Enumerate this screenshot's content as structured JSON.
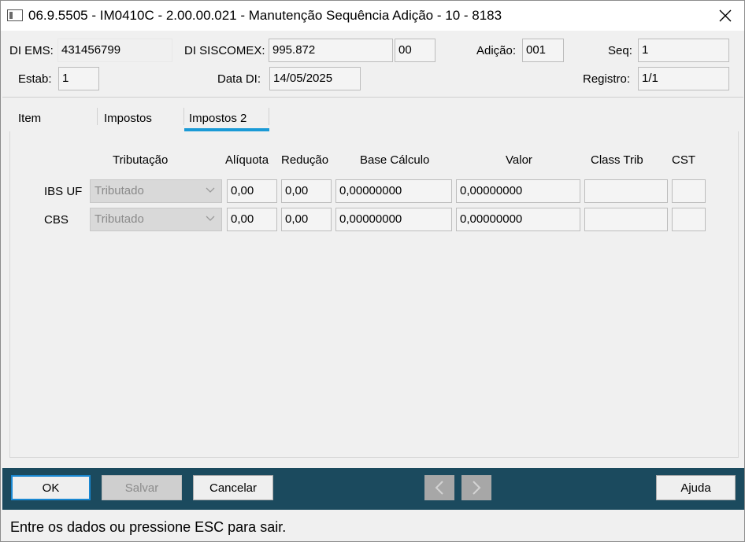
{
  "window": {
    "title": "06.9.5505 - IM0410C - 2.00.00.021 - Manutenção Sequência Adição - 10 - 8183",
    "icon": "app-window-icon",
    "close_icon": "close-icon"
  },
  "header": {
    "di_ems_label": "DI EMS:",
    "di_ems_value": "431456799",
    "di_siscomex_label": "DI SISCOMEX:",
    "di_siscomex_value": "995.872",
    "di_siscomex_suffix": "00",
    "adicao_label": "Adição:",
    "adicao_value": "001",
    "seq_label": "Seq:",
    "seq_value": "1",
    "estab_label": "Estab:",
    "estab_value": "1",
    "data_di_label": "Data DI:",
    "data_di_value": "14/05/2025",
    "registro_label": "Registro:",
    "registro_value": "1/1"
  },
  "tabs": [
    {
      "label": "Item",
      "active": false
    },
    {
      "label": "Impostos",
      "active": false
    },
    {
      "label": "Impostos 2",
      "active": true
    }
  ],
  "grid": {
    "columns": [
      "Tributação",
      "Alíquota",
      "Redução",
      "Base Cálculo",
      "Valor",
      "Class Trib",
      "CST"
    ],
    "rows": [
      {
        "label": "IBS UF",
        "tributacao": "Tributado",
        "aliquota": "0,00",
        "reducao": "0,00",
        "base_calculo": "0,00000000",
        "valor": "0,00000000",
        "class_trib": "",
        "cst": ""
      },
      {
        "label": "CBS",
        "tributacao": "Tributado",
        "aliquota": "0,00",
        "reducao": "0,00",
        "base_calculo": "0,00000000",
        "valor": "0,00000000",
        "class_trib": "",
        "cst": ""
      }
    ]
  },
  "footer": {
    "ok_label": "OK",
    "salvar_label": "Salvar",
    "cancelar_label": "Cancelar",
    "ajuda_label": "Ajuda",
    "prev_icon": "chevron-left-icon",
    "next_icon": "chevron-right-icon"
  },
  "status_text": "Entre os dados ou pressione ESC para sair.",
  "colors": {
    "footer_bg": "#1b4a5e",
    "tab_accent": "#1a9ad6",
    "primary_border": "#1a88d2"
  }
}
